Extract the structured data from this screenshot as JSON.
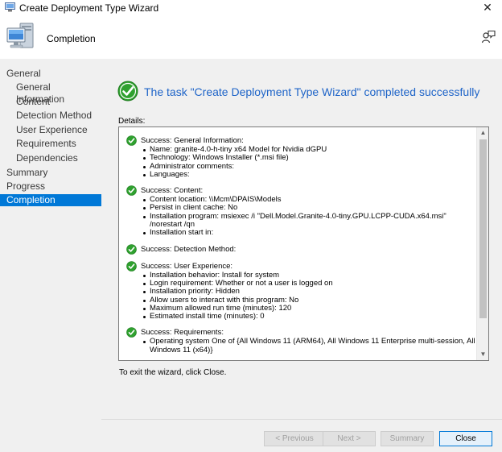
{
  "window": {
    "title": "Create Deployment Type Wizard",
    "close_glyph": "✕"
  },
  "header": {
    "page_heading": "Completion",
    "icons": [
      "computer-icon",
      "help-icon"
    ]
  },
  "nav": {
    "items": [
      {
        "label": "General",
        "level": 0,
        "active": false
      },
      {
        "label": "General Information",
        "level": 1,
        "active": false
      },
      {
        "label": "Content",
        "level": 1,
        "active": false
      },
      {
        "label": "Detection Method",
        "level": 1,
        "active": false
      },
      {
        "label": "User Experience",
        "level": 1,
        "active": false
      },
      {
        "label": "Requirements",
        "level": 1,
        "active": false
      },
      {
        "label": "Dependencies",
        "level": 1,
        "active": false
      },
      {
        "label": "Summary",
        "level": 0,
        "active": false
      },
      {
        "label": "Progress",
        "level": 0,
        "active": false
      },
      {
        "label": "Completion",
        "level": 0,
        "active": true
      }
    ]
  },
  "main": {
    "status_text": "The task \"Create Deployment Type Wizard\" completed successfully",
    "details_label": "Details:",
    "exit_text": "To exit the wizard, click Close.",
    "sections": [
      {
        "heading": "Success: General Information:",
        "items": [
          "Name: granite-4.0-h-tiny x64 Model for Nvidia dGPU",
          "Technology: Windows Installer (*.msi file)",
          "Administrator comments:",
          "Languages:"
        ]
      },
      {
        "heading": "Success: Content:",
        "items": [
          "Content location: \\\\Mcm\\DPAIS\\Models",
          "Persist in client cache: No",
          "Installation program: msiexec /i \"Dell.Model.Granite-4.0-tiny.GPU.LCPP-CUDA.x64.msi\" /norestart /qn",
          "Installation start in:"
        ]
      },
      {
        "heading": "Success: Detection Method:",
        "items": []
      },
      {
        "heading": "Success: User Experience:",
        "items": [
          "Installation behavior: Install for system",
          "Login requirement: Whether or not a user is logged on",
          "Installation priority: Hidden",
          "Allow users to interact with this program: No",
          "Maximum allowed run time (minutes): 120",
          "Estimated install time (minutes): 0"
        ]
      },
      {
        "heading": "Success: Requirements:",
        "items": [
          "Operating system  One of  {All Windows 11 (ARM64), All Windows 11 Enterprise multi-session, All Windows 11 (x64)}"
        ]
      }
    ]
  },
  "buttons": {
    "previous": "< Previous",
    "next": "Next >",
    "summary": "Summary",
    "close": "Close"
  },
  "colors": {
    "accent": "#0078d7",
    "status_text": "#1e64c8",
    "success_green": "#2fa12f"
  }
}
